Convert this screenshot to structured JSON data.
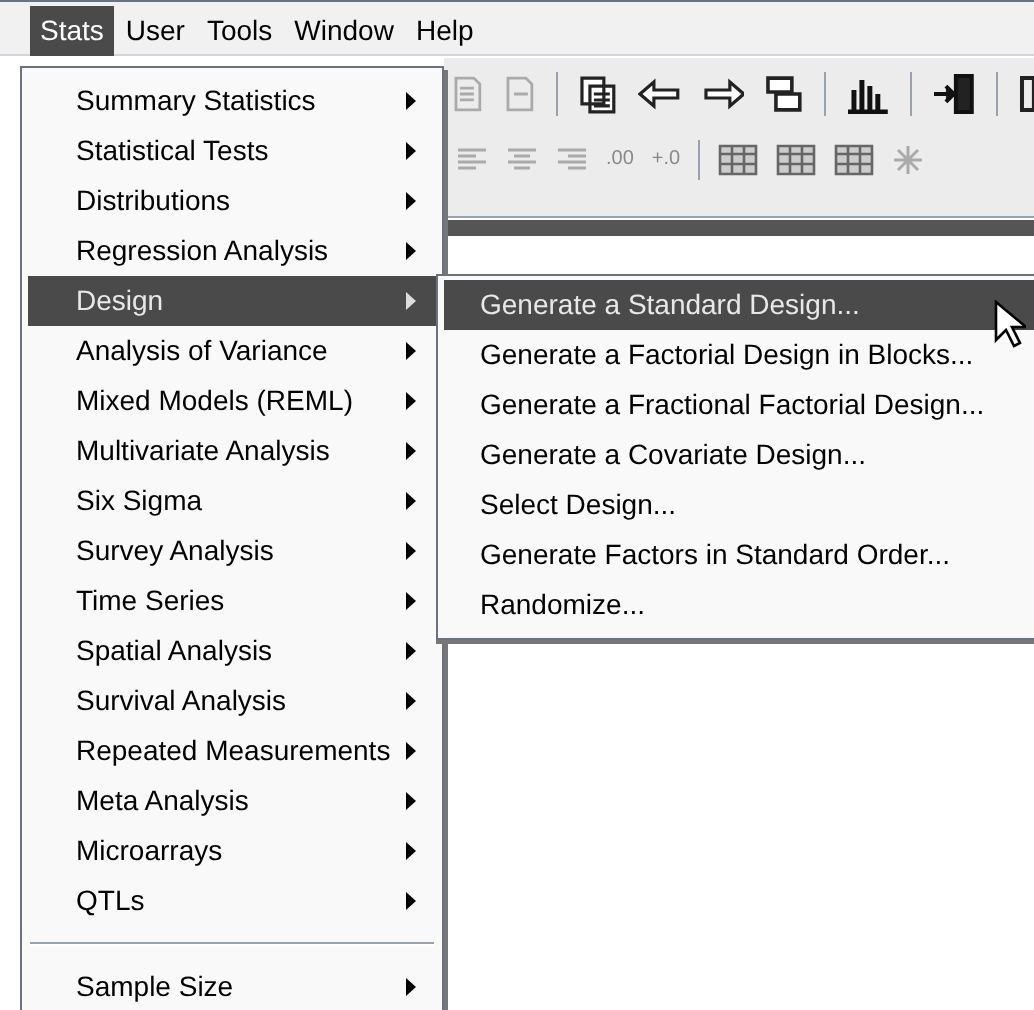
{
  "menubar": [
    {
      "label": "Stats",
      "selected": true
    },
    {
      "label": "User",
      "selected": false
    },
    {
      "label": "Tools",
      "selected": false
    },
    {
      "label": "Window",
      "selected": false
    },
    {
      "label": "Help",
      "selected": false
    }
  ],
  "toolbar": {
    "decimal_buttons": [
      ".00",
      "+.0"
    ]
  },
  "stats_menu": [
    {
      "kind": "item",
      "label": "Summary Statistics",
      "selected": false
    },
    {
      "kind": "item",
      "label": "Statistical Tests",
      "selected": false
    },
    {
      "kind": "item",
      "label": "Distributions",
      "selected": false
    },
    {
      "kind": "item",
      "label": "Regression Analysis",
      "selected": false
    },
    {
      "kind": "item",
      "label": "Design",
      "selected": true
    },
    {
      "kind": "item",
      "label": "Analysis of Variance",
      "selected": false
    },
    {
      "kind": "item",
      "label": "Mixed Models (REML)",
      "selected": false
    },
    {
      "kind": "item",
      "label": "Multivariate Analysis",
      "selected": false
    },
    {
      "kind": "item",
      "label": "Six Sigma",
      "selected": false
    },
    {
      "kind": "item",
      "label": "Survey Analysis",
      "selected": false
    },
    {
      "kind": "item",
      "label": "Time Series",
      "selected": false
    },
    {
      "kind": "item",
      "label": "Spatial Analysis",
      "selected": false
    },
    {
      "kind": "item",
      "label": "Survival Analysis",
      "selected": false
    },
    {
      "kind": "item",
      "label": "Repeated Measurements",
      "selected": false
    },
    {
      "kind": "item",
      "label": "Meta Analysis",
      "selected": false
    },
    {
      "kind": "item",
      "label": "Microarrays",
      "selected": false
    },
    {
      "kind": "item",
      "label": "QTLs",
      "selected": false
    },
    {
      "kind": "separator"
    },
    {
      "kind": "item",
      "label": "Sample Size",
      "selected": false
    }
  ],
  "design_submenu": [
    {
      "label": "Generate a Standard Design...",
      "selected": true
    },
    {
      "label": "Generate a Factorial Design in Blocks...",
      "selected": false
    },
    {
      "label": "Generate a Fractional Factorial Design...",
      "selected": false
    },
    {
      "label": "Generate a Covariate Design...",
      "selected": false
    },
    {
      "label": "Select Design...",
      "selected": false
    },
    {
      "label": "Generate Factors in Standard Order...",
      "selected": false
    },
    {
      "label": "Randomize...",
      "selected": false
    }
  ]
}
